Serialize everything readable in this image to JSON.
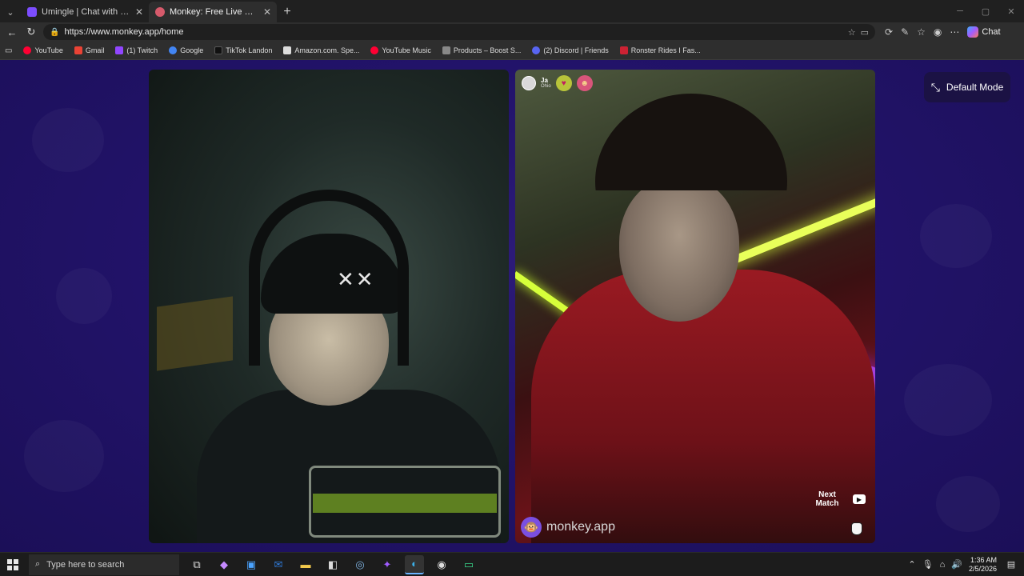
{
  "browser": {
    "tabs": [
      {
        "title": "Umingle | Chat with Strangers Inst",
        "color": "#7c4dff"
      },
      {
        "title": "Monkey: Free Live Video Chat",
        "color": "#d65a6b"
      }
    ],
    "new_tab_icon": "plus-icon",
    "url": "https://www.monkey.app/home",
    "chat_label": "Chat",
    "bookmarks": [
      {
        "label": "YouTube",
        "color": "#ff0033"
      },
      {
        "label": "Gmail",
        "color": "#ea4335"
      },
      {
        "label": "(1) Twitch",
        "color": "#9146ff"
      },
      {
        "label": "Google",
        "color": "#4285f4"
      },
      {
        "label": "TikTok Landon",
        "color": "#111111"
      },
      {
        "label": "Amazon.com. Spe...",
        "color": "#ff9900"
      },
      {
        "label": "YouTube Music",
        "color": "#ff0033"
      },
      {
        "label": "Products – Boost S...",
        "color": "#888888"
      },
      {
        "label": "(2) Discord | Friends",
        "color": "#5865f2"
      },
      {
        "label": "Ronster Rides I Fas...",
        "color": "#cc2233"
      }
    ]
  },
  "page": {
    "mode_button": "Default Mode",
    "remote_user": {
      "name": "Ja",
      "location": "Ohio"
    },
    "next_match_label": "Next Match",
    "brand_text": "monkey.app",
    "colors": {
      "background": "#22136a",
      "accent": "#7a4fe0"
    }
  },
  "taskbar": {
    "search_placeholder": "Type here to search",
    "time": "1:36 AM",
    "date": "2/5/2026"
  }
}
